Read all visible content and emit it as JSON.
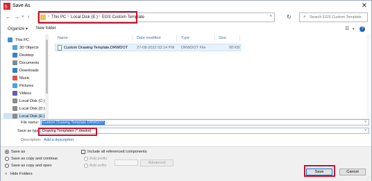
{
  "window": {
    "title": "Save As"
  },
  "nav": {
    "address_crumbs": [
      "This PC",
      "Local Disk (E:)",
      "EGS Custom Template"
    ],
    "search_placeholder": "Search EGS Custom Template"
  },
  "toolbar": {
    "organize": "Organize ▾",
    "new_folder": "New folder"
  },
  "sidebar": {
    "items": [
      {
        "label": "This PC",
        "icon": "computer-icon",
        "color": "#3c8fd6"
      },
      {
        "label": "3D Objects",
        "icon": "cube-icon",
        "color": "#4aa3df"
      },
      {
        "label": "Desktop",
        "icon": "desktop-icon",
        "color": "#3d7fc4"
      },
      {
        "label": "Documents",
        "icon": "documents-icon",
        "color": "#7a8a99"
      },
      {
        "label": "Downloads",
        "icon": "download-icon",
        "color": "#2d7fd1"
      },
      {
        "label": "Music",
        "icon": "music-icon",
        "color": "#d9534f"
      },
      {
        "label": "Pictures",
        "icon": "pictures-icon",
        "color": "#4aa3df"
      },
      {
        "label": "Videos",
        "icon": "videos-icon",
        "color": "#6b5bb5"
      },
      {
        "label": "Local Disk (C:)",
        "icon": "drive-icon",
        "color": "#8c8c8c"
      },
      {
        "label": "Local Disk (D:)",
        "icon": "drive-icon",
        "color": "#8c8c8c"
      },
      {
        "label": "Local Disk (E:)",
        "icon": "drive-icon",
        "color": "#8c8c8c"
      }
    ]
  },
  "files": {
    "columns": [
      "Name",
      "Date modified",
      "Type",
      "Size"
    ],
    "rows": [
      {
        "name": "Custom Drawing Template.DRWDOT",
        "date": "27-08-2022 03:14 PM",
        "type": "DRWDOT File",
        "size": "98 KB"
      }
    ]
  },
  "form": {
    "file_name_label": "File name:",
    "file_name_value": "Custom Drawing Template.DRWDOT",
    "save_as_type_label": "Save as type:",
    "save_as_type_value": "Drawing Templates (*.drwdot)",
    "description_label": "Description:",
    "description_link": "Add a description"
  },
  "options": {
    "save_as": "Save as",
    "save_as_copy_continue": "Save as copy and continue",
    "save_as_copy_open": "Save as copy and open",
    "include_components": "Include all referenced components",
    "add_prefix": "Add prefix",
    "add_suffix": "Add suffix",
    "advanced": "Advanced",
    "hide_folders": "Hide Folders"
  },
  "buttons": {
    "save": "Save",
    "cancel": "Cancel"
  },
  "colors": {
    "highlight": "#c8102e",
    "accent": "#0078d7",
    "selection": "#cce4f7"
  }
}
